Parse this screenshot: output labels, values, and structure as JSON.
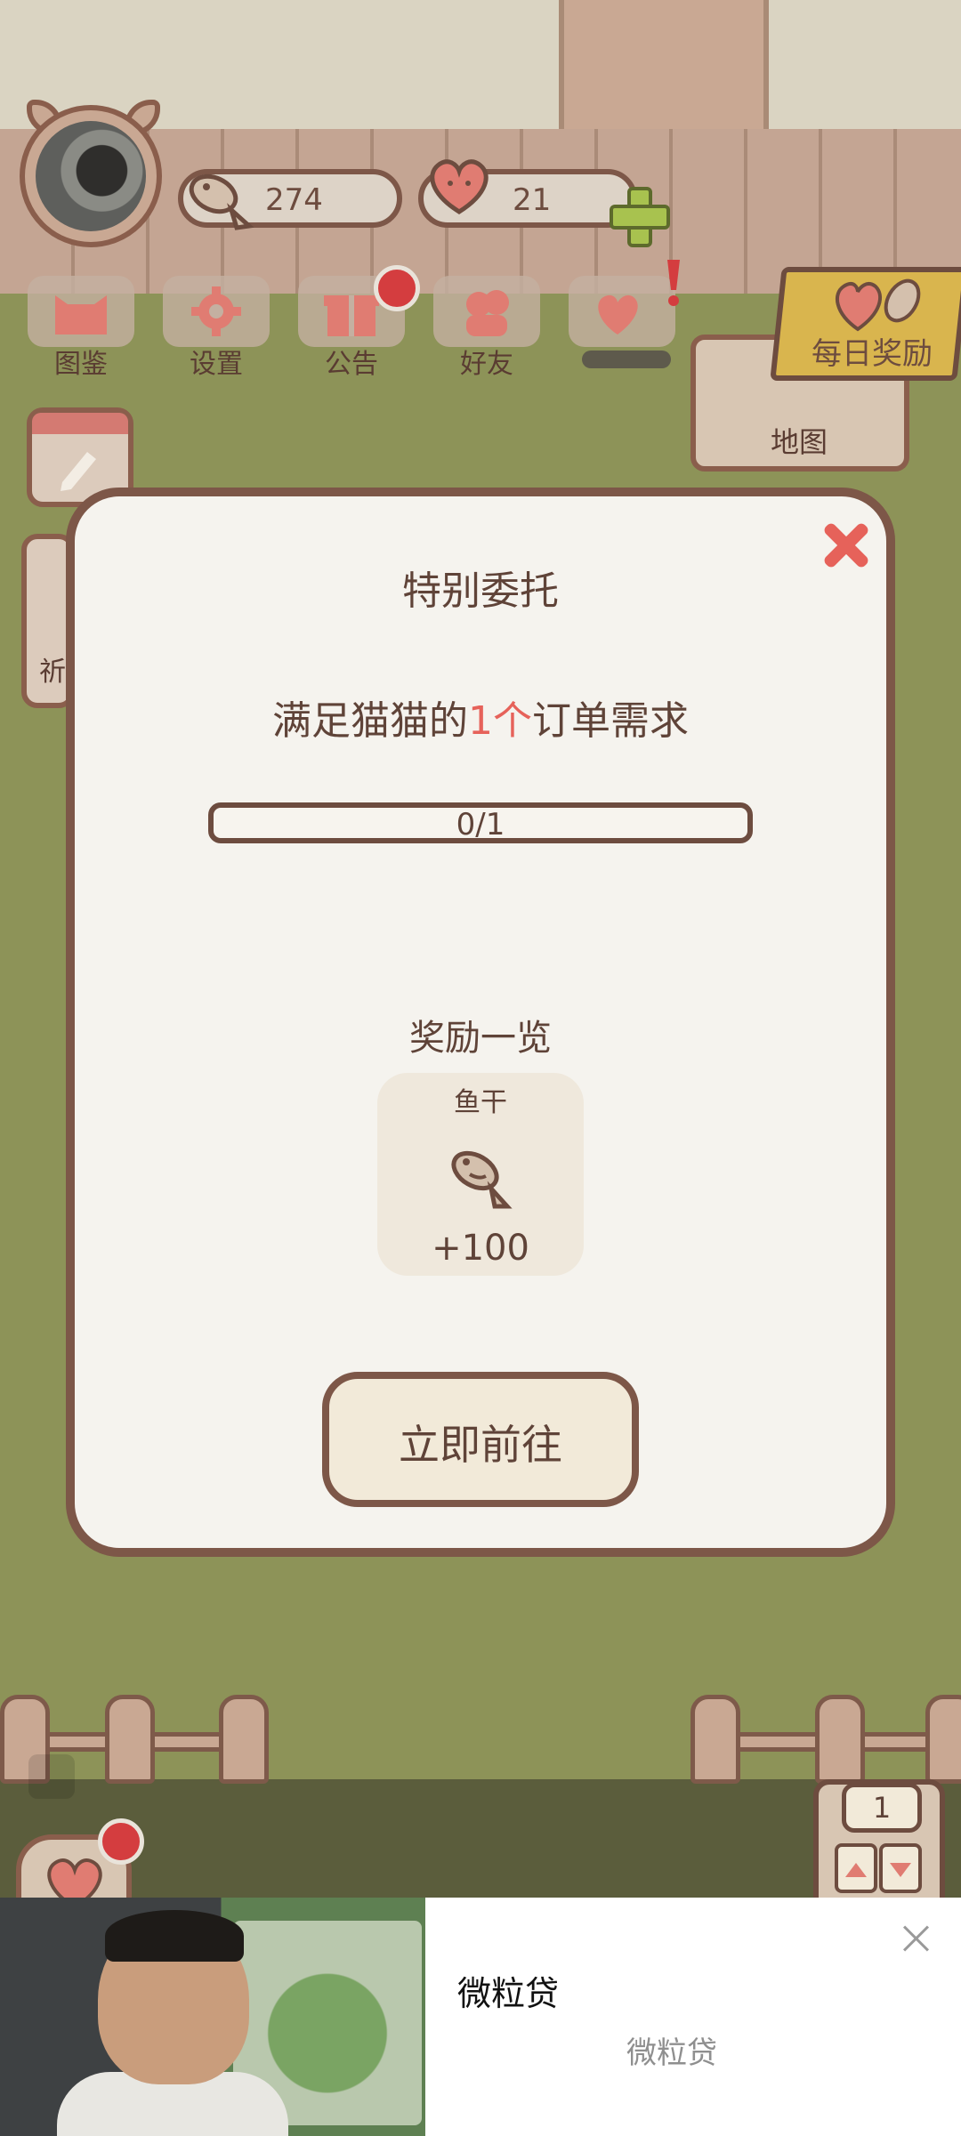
{
  "hud": {
    "fish_count": "274",
    "heart_count": "21"
  },
  "menu": {
    "items": [
      {
        "label": "图鉴",
        "icon": "cat-face-icon"
      },
      {
        "label": "设置",
        "icon": "gear-icon"
      },
      {
        "label": "公告",
        "icon": "gift-icon"
      },
      {
        "label": "好友",
        "icon": "friends-icon"
      }
    ]
  },
  "daily_reward": {
    "label": "每日奖励"
  },
  "map": {
    "label": "地图"
  },
  "side_tab": {
    "label": "祈"
  },
  "dialog": {
    "title": "特别委托",
    "desc_prefix": "满足猫猫的",
    "desc_highlight": "1个",
    "desc_suffix": "订单需求",
    "progress_text": "0/1",
    "progress_fraction": 0,
    "reward_heading": "奖励一览",
    "reward": {
      "name": "鱼干",
      "icon": "fish-icon",
      "amount": "+100"
    },
    "go_button": "立即前往"
  },
  "elevator": {
    "floor": "1"
  },
  "ad": {
    "title": "微粒贷",
    "subtitle": "微粒贷"
  },
  "colors": {
    "accent_red": "#e6625a",
    "border_brown": "#7d5748",
    "grass": "#8d9358"
  }
}
